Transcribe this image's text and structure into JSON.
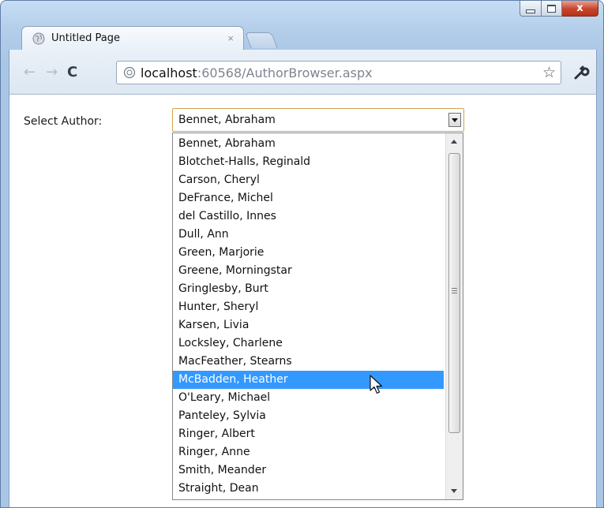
{
  "browser": {
    "tab_title": "Untitled Page",
    "tab_close": "×",
    "url_host": "localhost",
    "url_rest": ":60568/AuthorBrowser.aspx",
    "window_close": "x"
  },
  "page": {
    "label": "Select Author:",
    "selected_value": "Bennet, Abraham",
    "options": [
      "Bennet, Abraham",
      "Blotchet-Halls, Reginald",
      "Carson, Cheryl",
      "DeFrance, Michel",
      "del Castillo, Innes",
      "Dull, Ann",
      "Green, Marjorie",
      "Greene, Morningstar",
      "Gringlesby, Burt",
      "Hunter, Sheryl",
      "Karsen, Livia",
      "Locksley, Charlene",
      "MacFeather, Stearns",
      "McBadden, Heather",
      "O'Leary, Michael",
      "Panteley, Sylvia",
      "Ringer, Albert",
      "Ringer, Anne",
      "Smith, Meander",
      "Straight, Dean"
    ],
    "highlighted_option": "McBadden, Heather"
  },
  "colors": {
    "highlight": "#3399ff",
    "focus_border": "#d3a24a"
  }
}
